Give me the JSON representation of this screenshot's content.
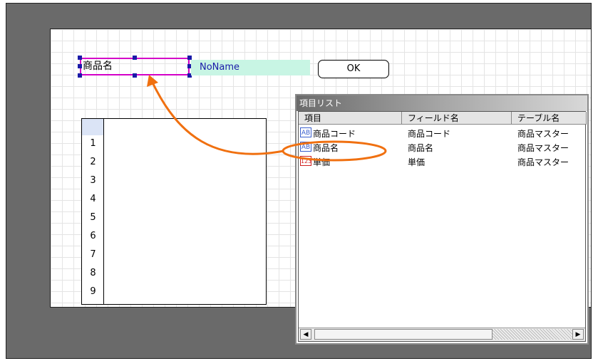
{
  "form": {
    "label_field_value": "商品名",
    "nname_value": "NoName",
    "ok_label": "OK"
  },
  "grid": {
    "row_numbers": [
      "1",
      "2",
      "3",
      "4",
      "5",
      "6",
      "7",
      "8",
      "9"
    ]
  },
  "item_list": {
    "title": "項目リスト",
    "columns": [
      "項目",
      "フィールド名",
      "テーブル名"
    ],
    "rows": [
      {
        "icon": "text-field-icon",
        "icon_text": "AB",
        "item": "商品コード",
        "field": "商品コード",
        "table": "商品マスター"
      },
      {
        "icon": "text-field-icon",
        "icon_text": "AB",
        "item": "商品名",
        "field": "商品名",
        "table": "商品マスター"
      },
      {
        "icon": "numeric-field-icon",
        "icon_text": "123",
        "item": "単価",
        "field": "単価",
        "table": "商品マスター"
      }
    ],
    "scroll_left": "◀",
    "scroll_right": "▶"
  },
  "colors": {
    "selection": "#d400c8",
    "annotation": "#f07010",
    "handle": "#1a1aa8"
  }
}
